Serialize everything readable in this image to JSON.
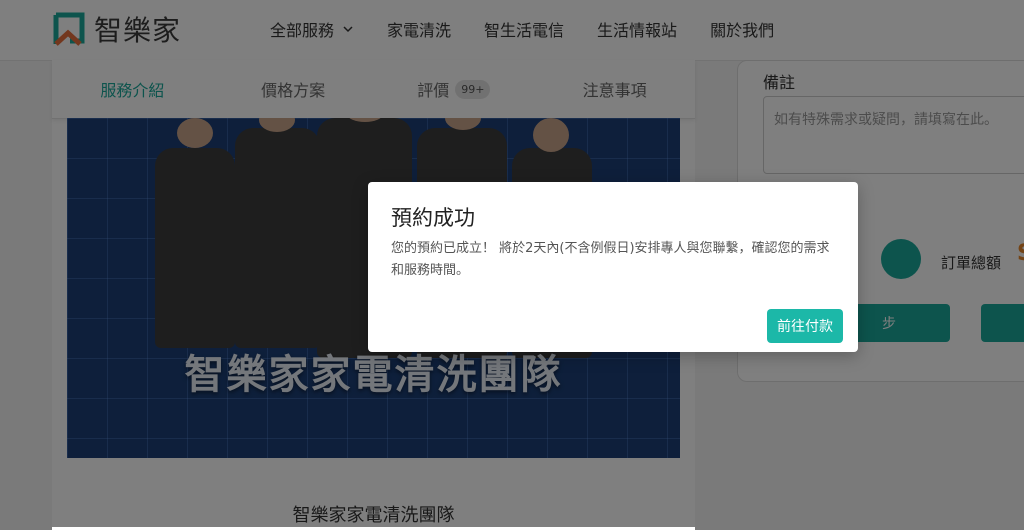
{
  "header": {
    "logo_text": "智樂家",
    "nav": [
      {
        "label": "全部服務",
        "has_dropdown": true
      },
      {
        "label": "家電清洗"
      },
      {
        "label": "智生活電信"
      },
      {
        "label": "生活情報站"
      },
      {
        "label": "關於我們"
      }
    ]
  },
  "tabs": [
    {
      "label": "服務介紹",
      "active": true
    },
    {
      "label": "價格方案"
    },
    {
      "label": "評價",
      "badge": "99+"
    },
    {
      "label": "注意事項"
    }
  ],
  "hero": {
    "caption": "智樂家家電清洗團隊"
  },
  "main": {
    "subtitle": "智樂家家電清洗團隊"
  },
  "sidebar": {
    "notes_label": "備註",
    "notes_placeholder": "如有特殊需求或疑問，請填寫在此。",
    "total_label": "訂單總額",
    "total_amount": "S",
    "prev_button_fragment": "步"
  },
  "modal": {
    "title": "預約成功",
    "body": "您的預約已成立！ 將於2天內(不含例假日)安排專人與您聯繫，確認您的需求和服務時間。",
    "button": "前往付款"
  },
  "colors": {
    "accent": "#1aa89a",
    "modal_button": "#1cb8a8",
    "overlay": "rgba(0,0,0,0.5)"
  }
}
